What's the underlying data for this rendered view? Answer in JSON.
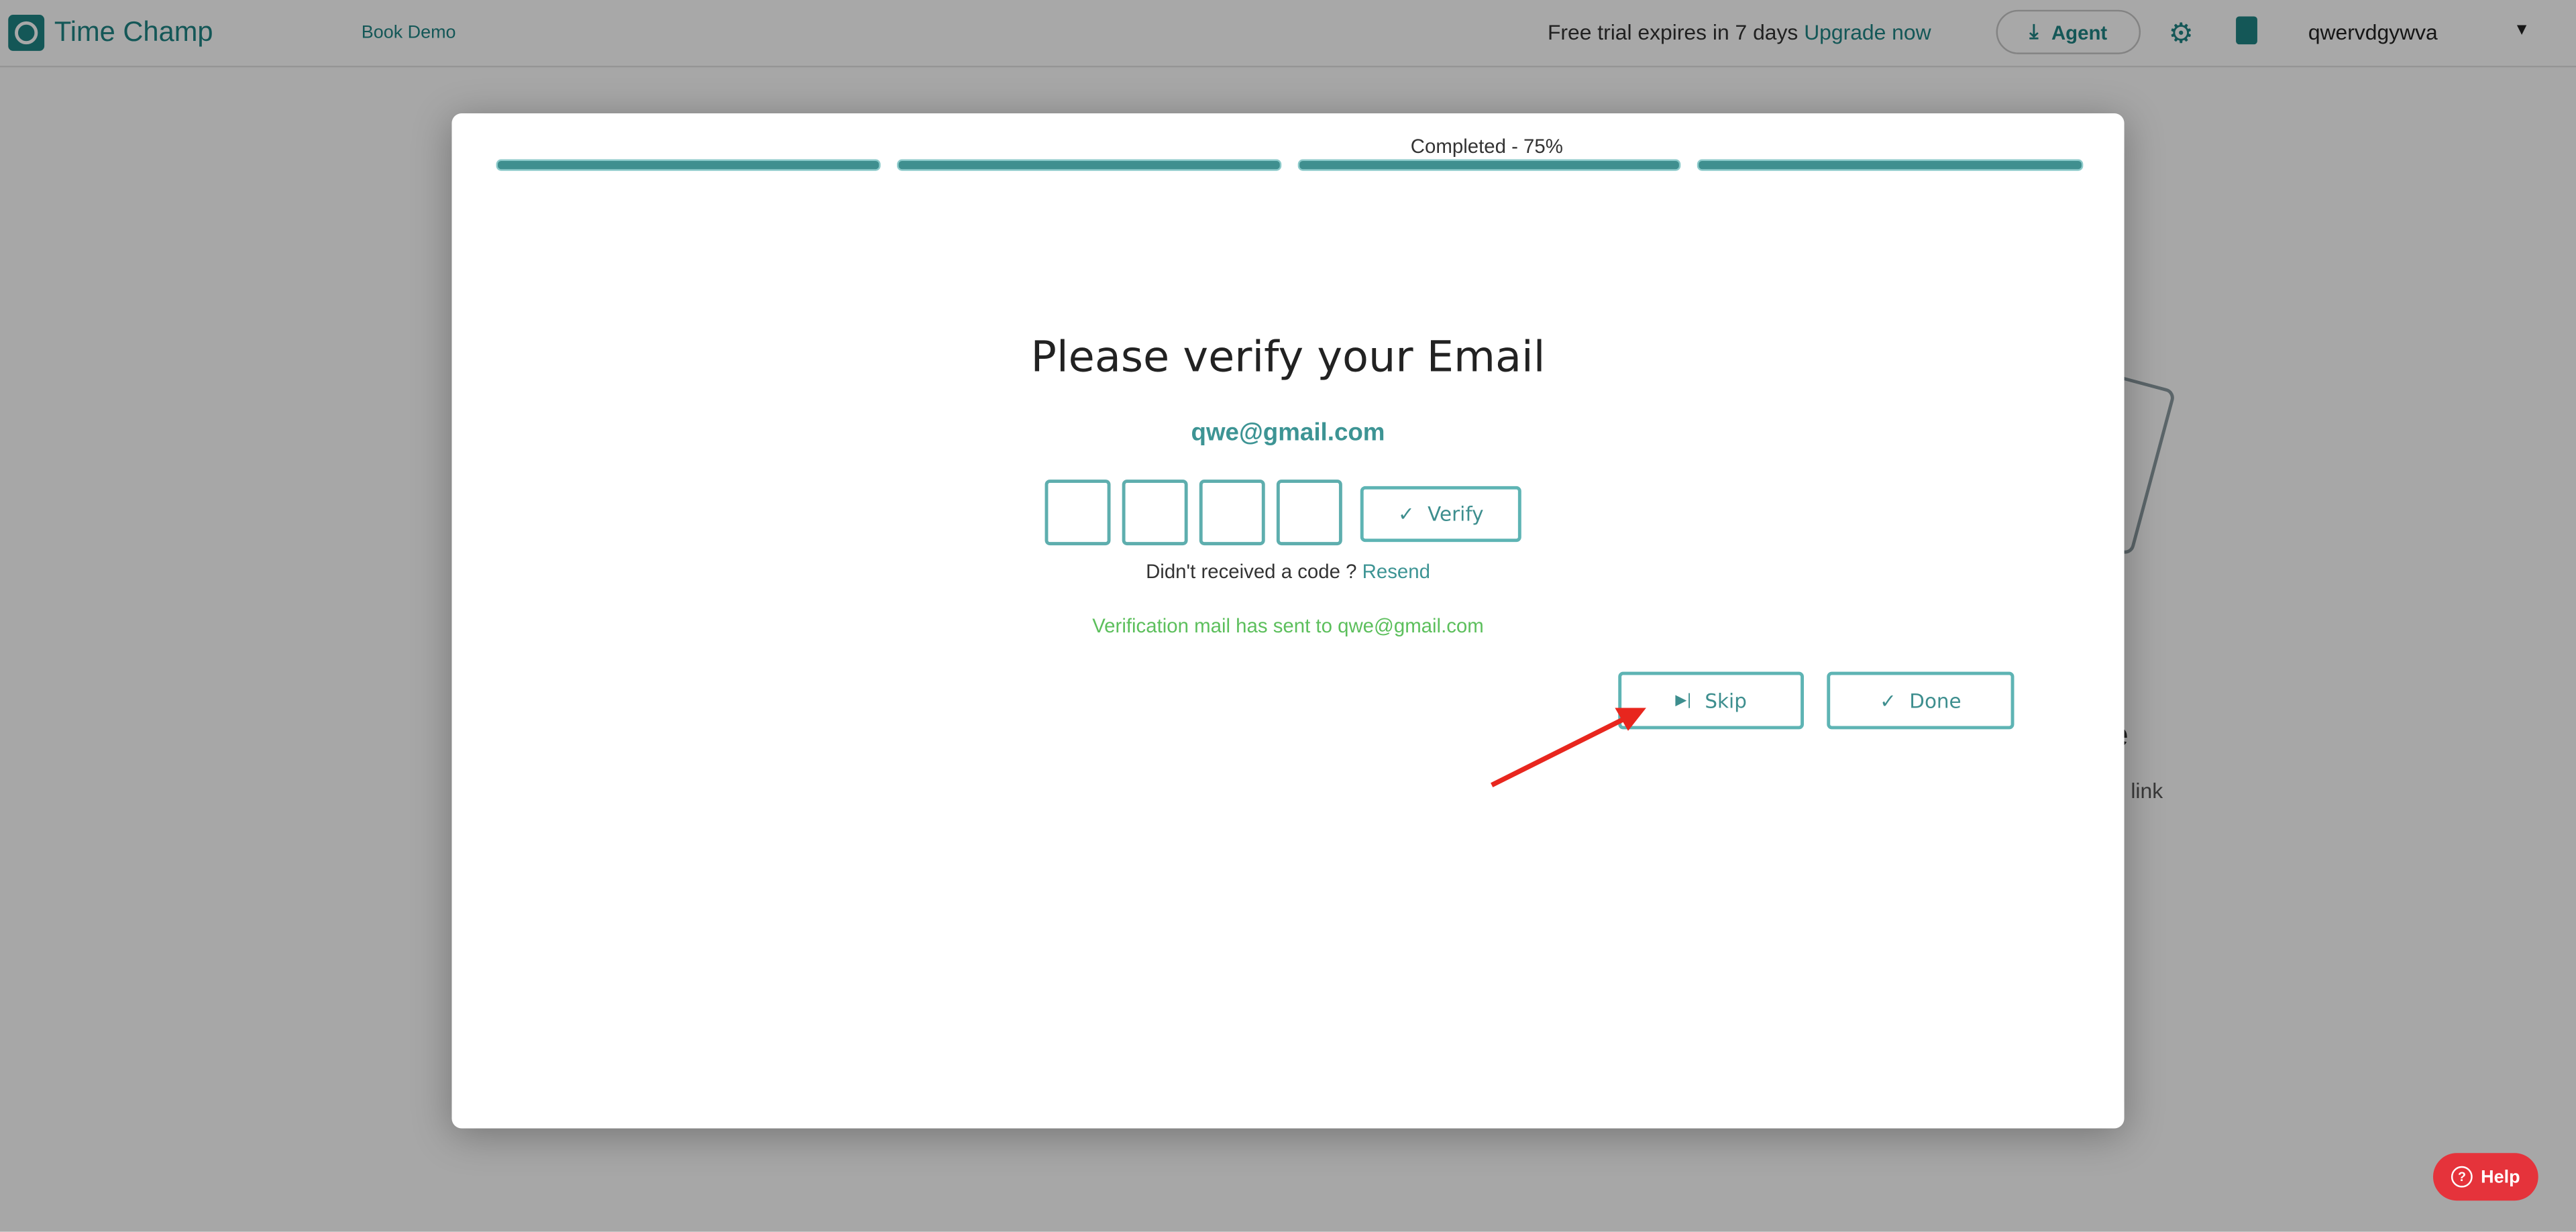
{
  "header": {
    "app_name": "Time Champ",
    "book_demo": "Book Demo",
    "trial_text": "Free trial expires in 7 days",
    "upgrade_link": "Upgrade now",
    "agent_button": "Agent",
    "username": "qwervdgywva",
    "icons": [
      "clock-logo-icon",
      "download-icon",
      "gear-icon",
      "clipboard-icon",
      "caret-down-icon"
    ]
  },
  "background": {
    "fragment_1": "le",
    "fragment_2": "link"
  },
  "modal": {
    "progress_label": "Completed - 75%",
    "progress_percent": 75,
    "progress_segments": 4,
    "title": "Please verify your Email",
    "email": "qwe@gmail.com",
    "otp_values": [
      "",
      "",
      "",
      ""
    ],
    "verify_button": "Verify",
    "no_code_text": "Didn't received a code ?",
    "resend_link": "Resend",
    "status_message": "Verification mail has sent to qwe@gmail.com",
    "skip_button": "Skip",
    "done_button": "Done"
  },
  "help_button": "Help",
  "colors": {
    "accent": "#1f8585",
    "progress": "#3f8f8f",
    "success": "#5cbf5c",
    "help": "#e5333b",
    "annotation_arrow": "#e8261e"
  }
}
